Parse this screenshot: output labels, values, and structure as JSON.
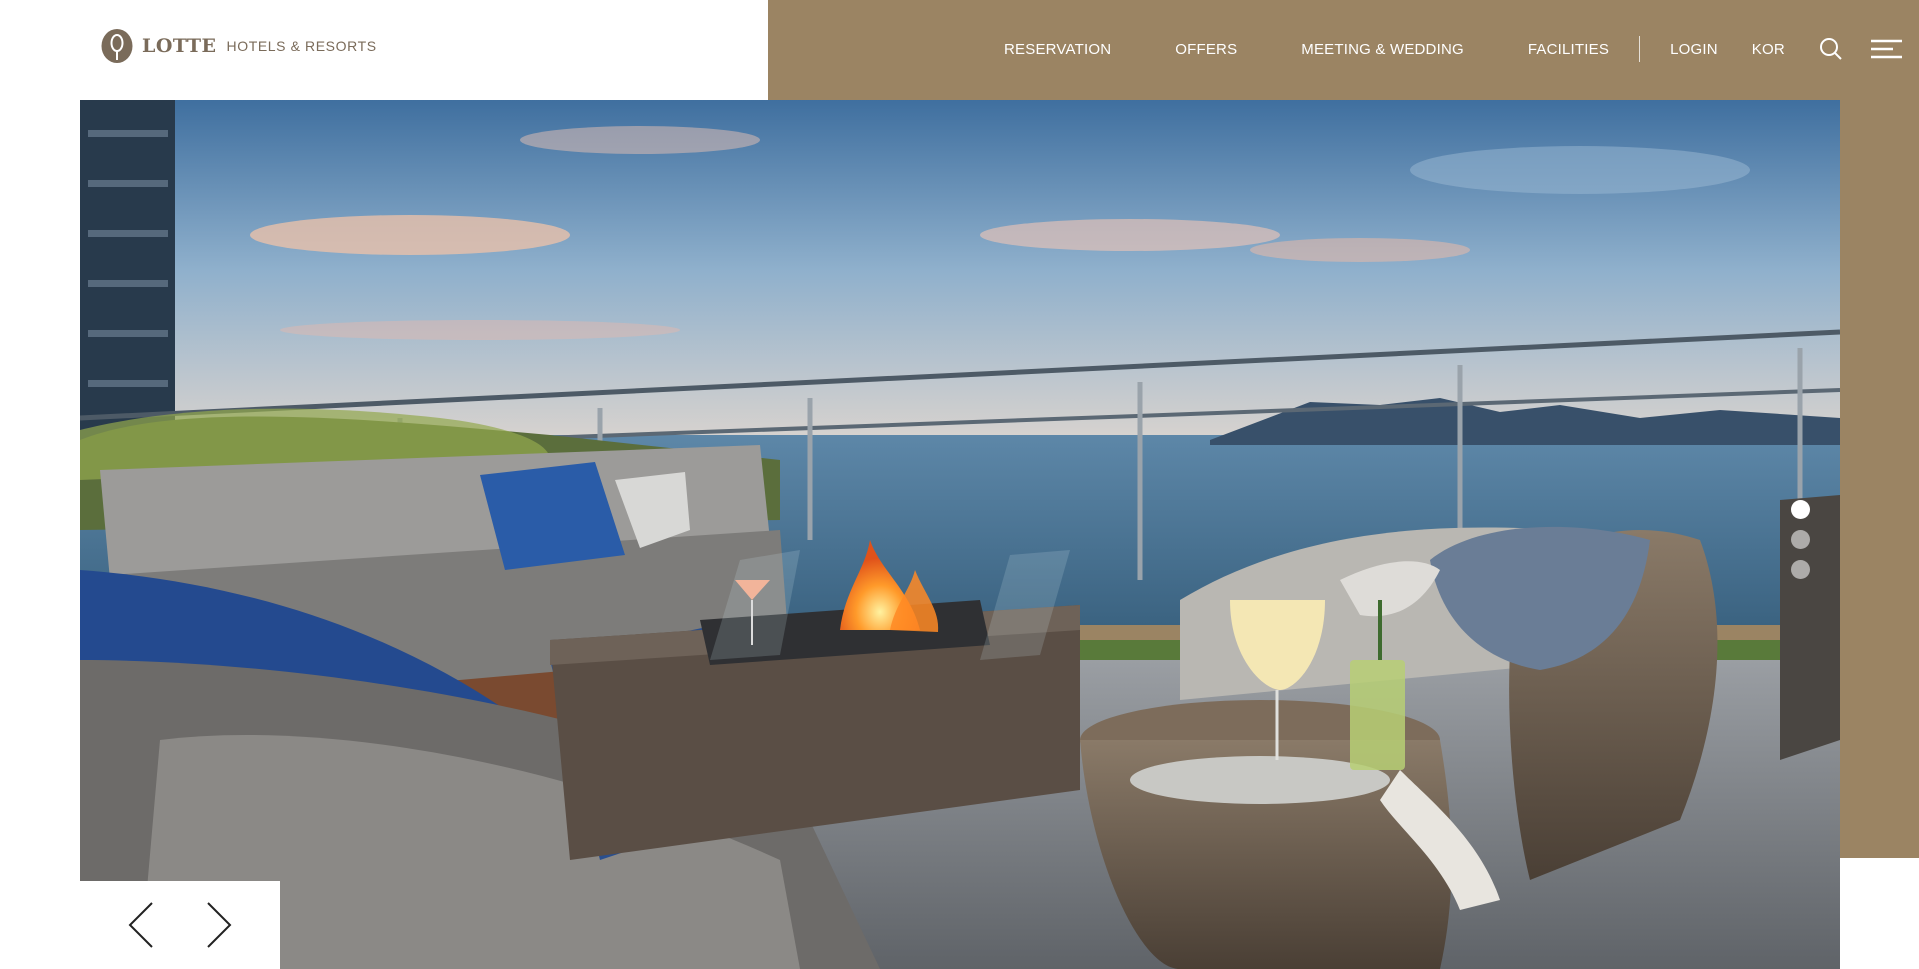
{
  "brand": {
    "name": "LOTTE",
    "sub": "HOTELS & RESORTS",
    "logo_icon": "lotte-emblem-icon",
    "color": "#7a6b5a"
  },
  "header": {
    "accent_color": "#9b8463",
    "nav": [
      {
        "label": "RESERVATION"
      },
      {
        "label": "OFFERS"
      },
      {
        "label": "MEETING & WEDDING"
      },
      {
        "label": "FACILITIES"
      }
    ],
    "login_label": "LOGIN",
    "language_label": "KOR",
    "search_icon": "search-icon",
    "menu_icon": "hamburger-menu-icon"
  },
  "hero": {
    "image": "rooftop-terrace-ocean-view-photo",
    "slide_count": 3,
    "active_slide": 1,
    "prev_icon": "chevron-left-icon",
    "next_icon": "chevron-right-icon"
  }
}
